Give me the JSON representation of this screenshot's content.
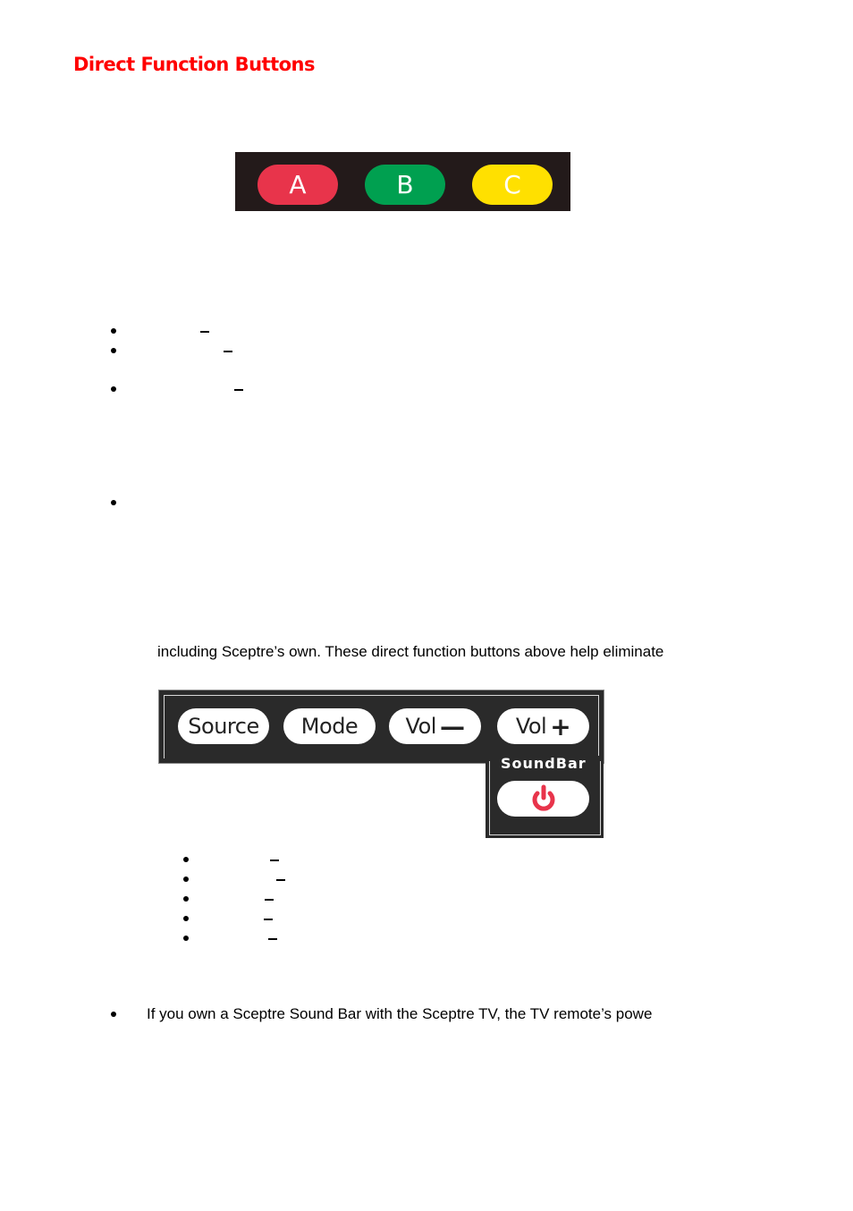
{
  "heading": "Direct Function Buttons",
  "abc_buttons": [
    {
      "label": "A",
      "color": "#e8344b"
    },
    {
      "label": "B",
      "color": "#00a050"
    },
    {
      "label": "C",
      "color": "#ffe000"
    }
  ],
  "paragraph_1": "including Sceptre’s own. These direct function buttons above help eliminate",
  "soundbar_panel": {
    "buttons": [
      {
        "label": "Source"
      },
      {
        "label": "Mode"
      },
      {
        "label": "Vol",
        "symbol": "—"
      },
      {
        "label": "Vol",
        "symbol": "+"
      }
    ],
    "section_label": "SoundBar",
    "power_icon_color": "#e8344b"
  },
  "bullet_last": "If you own a Sceptre Sound Bar with the Sceptre TV, the TV remote’s powe",
  "colors": {
    "heading": "#ff0000",
    "panel_bg": "#2a2a2a"
  }
}
